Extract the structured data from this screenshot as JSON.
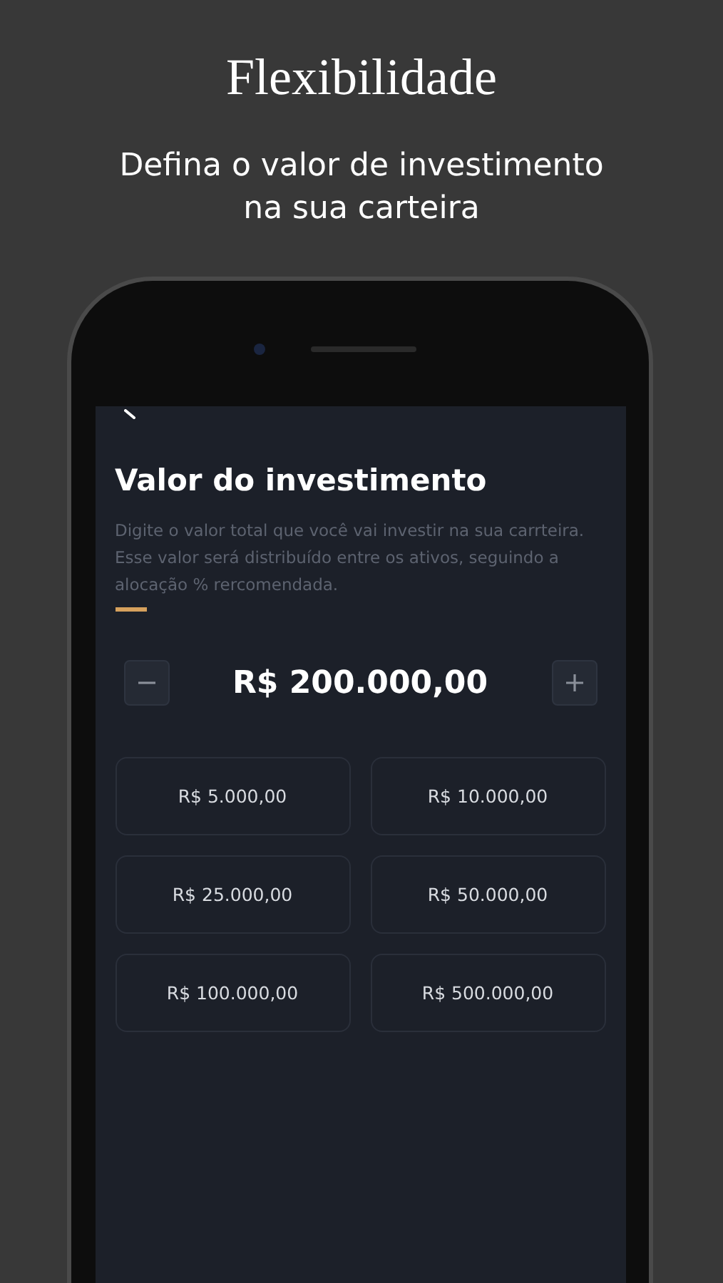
{
  "headline": "Flexibilidade",
  "subheadline": "Defina o valor de investimento na sua carteira",
  "screen": {
    "title": "Valor do investimento",
    "description": "Digite o valor total que você vai investir na sua carrteira. Esse valor será distribuído entre os ativos, seguindo a alocação % rercomendada.",
    "amount": "R$ 200.000,00",
    "presets": [
      {
        "label": "R$ 5.000,00"
      },
      {
        "label": "R$ 10.000,00"
      },
      {
        "label": "R$ 25.000,00"
      },
      {
        "label": "R$ 50.000,00"
      },
      {
        "label": "R$ 100.000,00"
      },
      {
        "label": "R$ 500.000,00"
      }
    ]
  }
}
